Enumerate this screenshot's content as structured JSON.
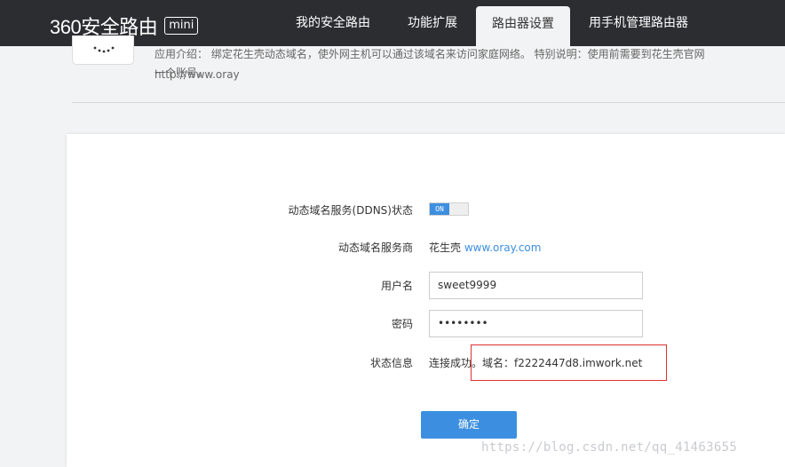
{
  "header": {
    "logo_text": "360安全路由",
    "logo_badge": "mini",
    "nav": [
      {
        "label": "我的安全路由"
      },
      {
        "label": "功能扩展"
      },
      {
        "label": "路由器设置"
      },
      {
        "label": "用手机管理路由器"
      }
    ]
  },
  "intro": {
    "line1": "应用介绍：  绑定花生壳动态域名，使外网主机可以通过该域名来访问家庭网络。  特别说明：使用前需要到花生壳官网http://www.oray",
    "line2": "一个账号。"
  },
  "form": {
    "ddns_label": "动态域名服务(DDNS)状态",
    "ddns_toggle": "ON",
    "provider_label": "动态域名服务商",
    "provider_name": "花生壳",
    "provider_link": "www.oray.com",
    "username_label": "用户名",
    "username_value": "sweet9999",
    "password_label": "密码",
    "password_value": "••••••••",
    "status_label": "状态信息",
    "status_text": "连接成功。域名：f2222447d8.imwork.net",
    "submit_label": "确定"
  },
  "watermark": "https://blog.csdn.net/qq_41463655",
  "colors": {
    "topbar": "#2c2d31",
    "accent": "#3c8fe0",
    "highlight": "#e0312f"
  }
}
